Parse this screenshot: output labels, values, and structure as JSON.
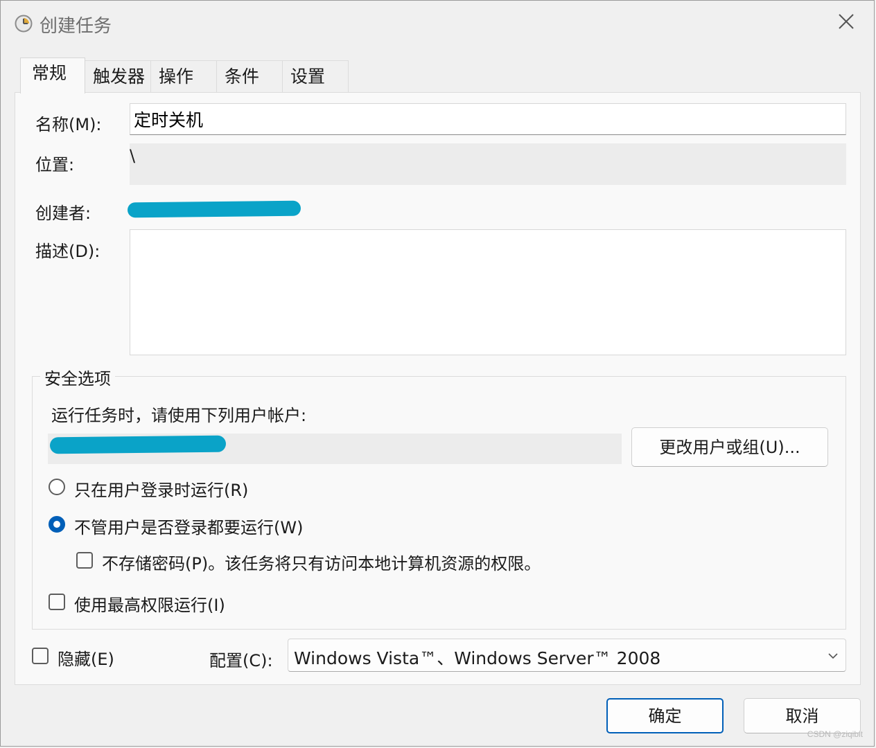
{
  "window": {
    "title": "创建任务"
  },
  "tabs": [
    {
      "label": "常规",
      "active": true
    },
    {
      "label": "触发器",
      "active": false
    },
    {
      "label": "操作",
      "active": false
    },
    {
      "label": "条件",
      "active": false
    },
    {
      "label": "设置",
      "active": false
    }
  ],
  "general": {
    "name_label": "名称(M):",
    "name_value": "定时关机",
    "location_label": "位置:",
    "location_value": "\\",
    "author_label": "创建者:",
    "description_label": "描述(D):",
    "description_value": ""
  },
  "security": {
    "legend": "安全选项",
    "run_as_label": "运行任务时，请使用下列用户帐户:",
    "change_user_button": "更改用户或组(U)...",
    "option_logged_on": {
      "label": "只在用户登录时运行(R)",
      "checked": false
    },
    "option_always": {
      "label": "不管用户是否登录都要运行(W)",
      "checked": true
    },
    "do_not_store_password": {
      "label": "不存储密码(P)。该任务将只有访问本地计算机资源的权限。",
      "checked": false
    },
    "highest_privileges": {
      "label": "使用最高权限运行(I)",
      "checked": false
    }
  },
  "bottom": {
    "hidden": {
      "label": "隐藏(E)",
      "checked": false
    },
    "config_label": "配置(C):",
    "config_value": "Windows Vista™、Windows Server™ 2008"
  },
  "dialog_buttons": {
    "ok": "确定",
    "cancel": "取消"
  },
  "watermark": "CSDN @ziqibit",
  "colors": {
    "accent": "#005fb8",
    "redaction": "#0aa3c8"
  }
}
